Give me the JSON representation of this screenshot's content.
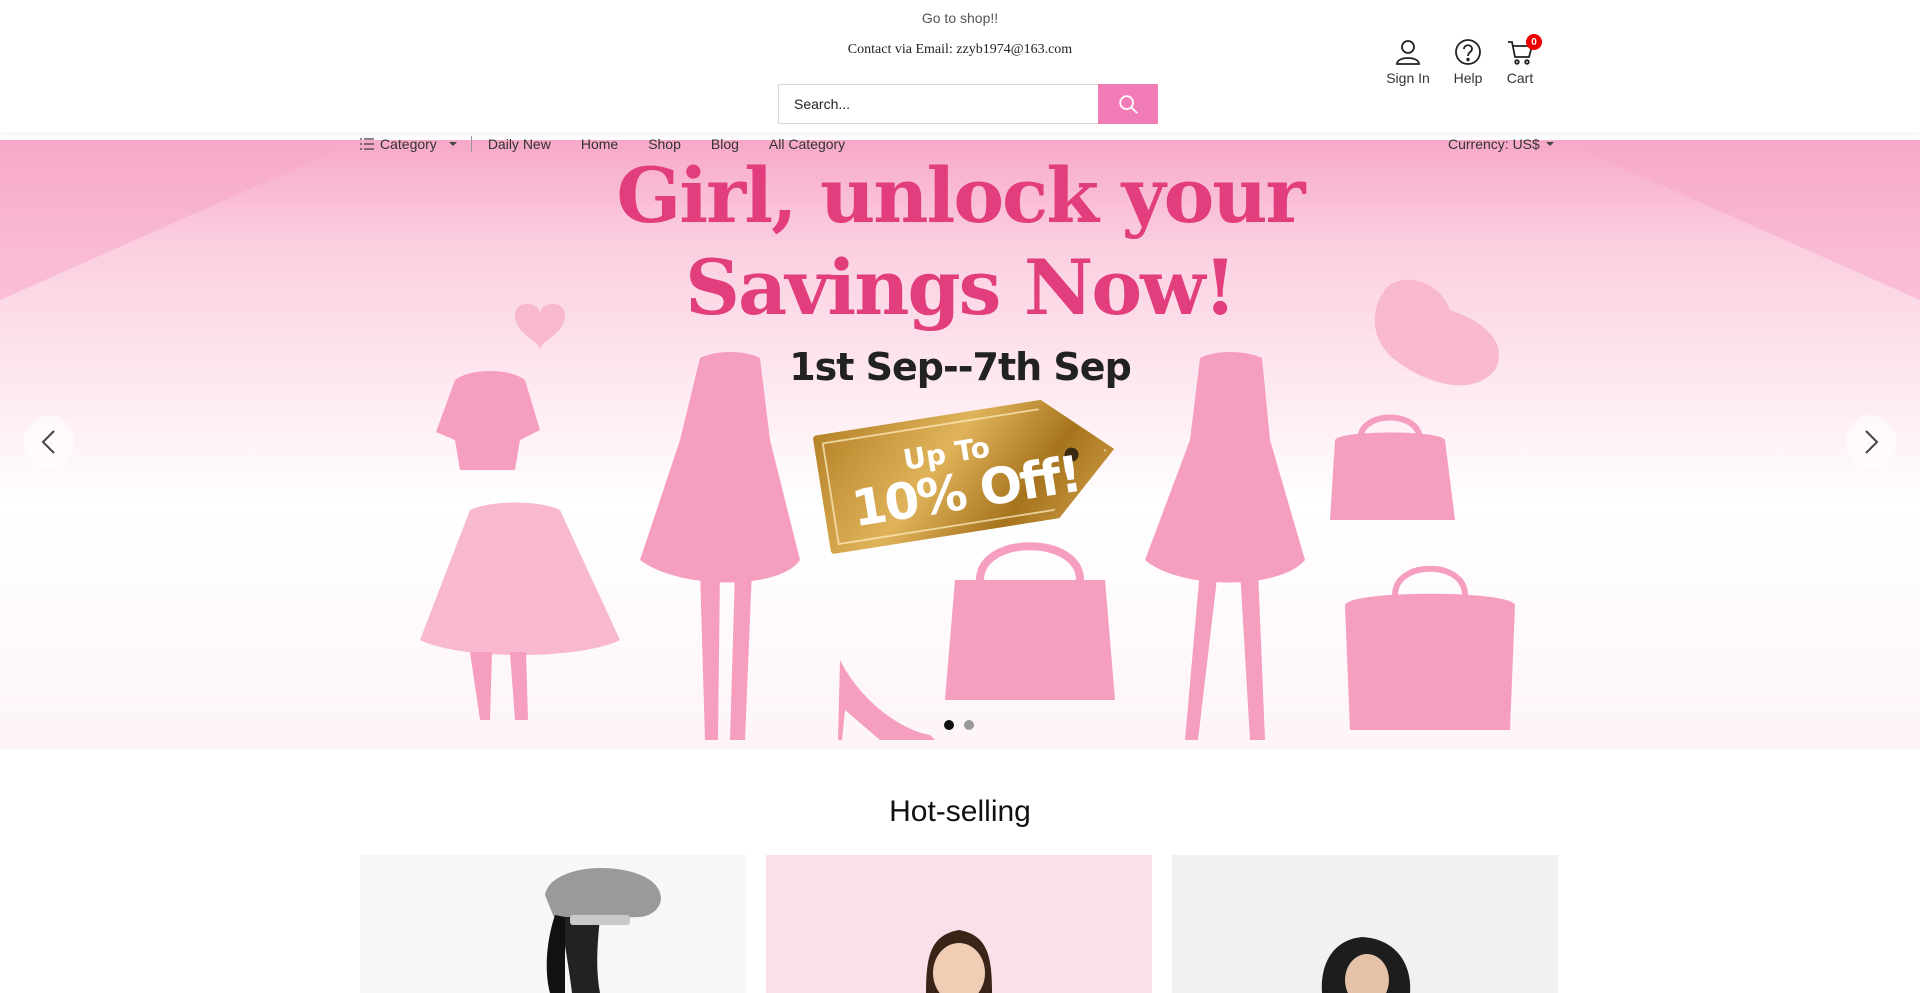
{
  "header": {
    "promo_text": "Go to shop!!",
    "contact_text": "Contact via Email: zzyb1974@163.com",
    "search_placeholder": "Search...",
    "icons": {
      "signin_label": "Sign In",
      "help_label": "Help",
      "cart_label": "Cart",
      "cart_count": "0"
    }
  },
  "nav": {
    "category_label": "Category",
    "items": [
      "Daily New",
      "Home",
      "Shop",
      "Blog",
      "All Category"
    ],
    "currency_label": "Currency: US$"
  },
  "banner": {
    "headline_line1": "Girl, unlock your",
    "headline_line2": "Savings Now!",
    "date_range": "1st Sep--7th Sep",
    "tag_top": "Up To",
    "tag_main": "10% Off!",
    "slide_count": 2,
    "active_slide": 1
  },
  "hot_selling": {
    "title": "Hot-selling"
  },
  "colors": {
    "accent": "#f27cb6",
    "headline": "#e23d7c",
    "badge": "#e00000"
  }
}
